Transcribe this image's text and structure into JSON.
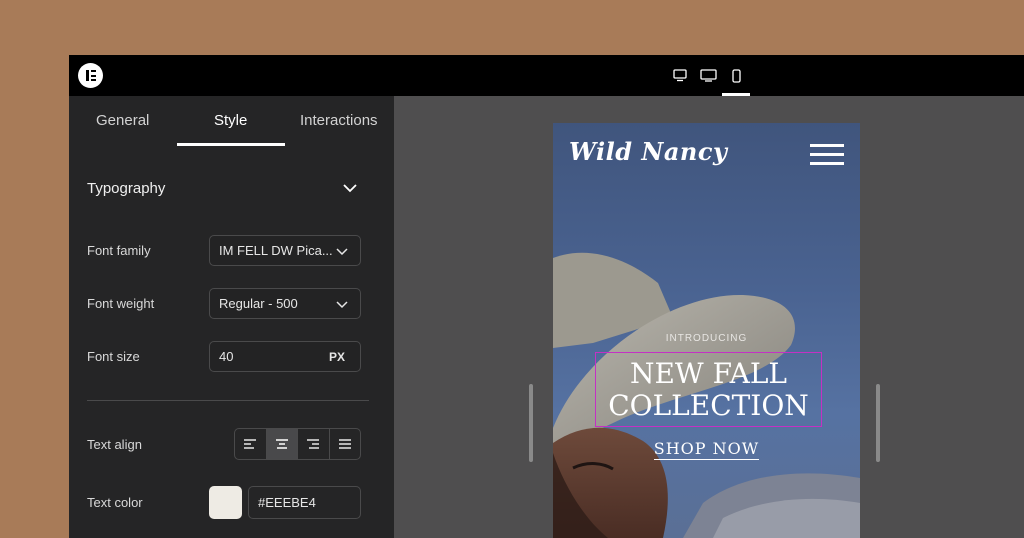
{
  "topbar": {
    "logo_icon": "elementor-logo-icon",
    "devices": [
      {
        "name": "desktop-small-icon",
        "active": false
      },
      {
        "name": "desktop-icon",
        "active": false
      },
      {
        "name": "mobile-icon",
        "active": true
      }
    ]
  },
  "panel": {
    "tabs": [
      {
        "label": "General",
        "active": false
      },
      {
        "label": "Style",
        "active": true
      },
      {
        "label": "Interactions",
        "active": false
      }
    ],
    "section": {
      "title": "Typography",
      "expanded": true
    },
    "font_family": {
      "label": "Font family",
      "value": "IM FELL DW Pica..."
    },
    "font_weight": {
      "label": "Font weight",
      "value": "Regular - 500"
    },
    "font_size": {
      "label": "Font size",
      "value": "40",
      "unit": "PX"
    },
    "text_align": {
      "label": "Text align",
      "options": [
        "align-left",
        "align-center",
        "align-right",
        "align-justify"
      ],
      "selected": "align-center"
    },
    "text_color": {
      "label": "Text color",
      "value": "#EEEBE4",
      "swatch": "#eeebe4"
    }
  },
  "canvas": {
    "brand": "Wild Nancy",
    "intro": "INTRODUCING",
    "headline_line1": "NEW FALL",
    "headline_line2": "COLLECTION",
    "cta": "SHOP NOW"
  },
  "colors": {
    "page_background": "#a87b58",
    "panel": "#252526",
    "workspace": "#4f4e4f",
    "selection_outline": "#c431c4"
  }
}
